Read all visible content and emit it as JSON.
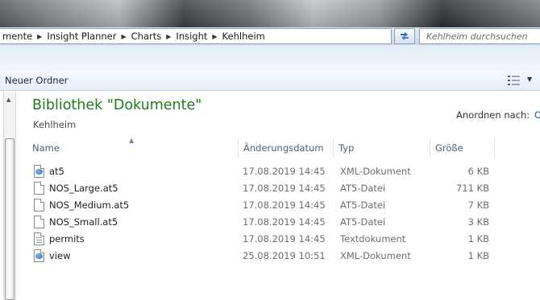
{
  "address": {
    "crumbs": [
      "mente",
      "Insight Planner",
      "Charts",
      "Insight",
      "Kehlheim"
    ],
    "search_placeholder": "Kehlheim durchsuchen"
  },
  "toolbar": {
    "new_folder_label": "Neuer Ordner"
  },
  "library": {
    "title": "Bibliothek \"Dokumente\"",
    "subtitle": "Kehlheim",
    "arrange_label": "Anordnen nach:",
    "arrange_value": "O"
  },
  "columns": {
    "name": "Name",
    "date": "Änderungsdatum",
    "type": "Typ",
    "size": "Größe"
  },
  "files": [
    {
      "name": "at5",
      "date": "17.08.2019 14:45",
      "type": "XML-Dokument",
      "size": "6 KB",
      "icon": "xml-file-icon"
    },
    {
      "name": "NOS_Large.at5",
      "date": "17.08.2019 14:45",
      "type": "AT5-Datei",
      "size": "711 KB",
      "icon": "file-icon"
    },
    {
      "name": "NOS_Medium.at5",
      "date": "17.08.2019 14:45",
      "type": "AT5-Datei",
      "size": "7 KB",
      "icon": "file-icon"
    },
    {
      "name": "NOS_Small.at5",
      "date": "17.08.2019 14:45",
      "type": "AT5-Datei",
      "size": "3 KB",
      "icon": "file-icon"
    },
    {
      "name": "permits",
      "date": "17.08.2019 14:45",
      "type": "Textdokument",
      "size": "1 KB",
      "icon": "text-file-icon"
    },
    {
      "name": "view",
      "date": "25.08.2019 10:51",
      "type": "XML-Dokument",
      "size": "1 KB",
      "icon": "xml-file-icon"
    }
  ]
}
